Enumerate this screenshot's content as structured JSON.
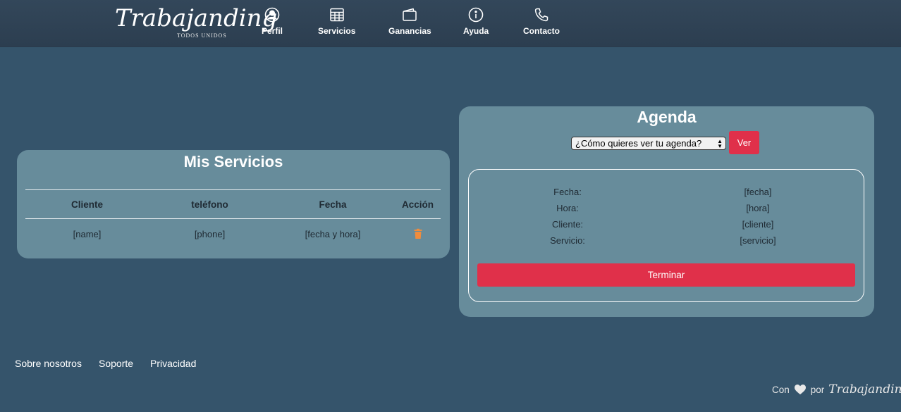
{
  "brand": {
    "name": "Trabajanding",
    "tagline": "TODOS UNIDOS"
  },
  "nav": [
    {
      "label": "Perfil",
      "icon": "person-circle-icon"
    },
    {
      "label": "Servicios",
      "icon": "table-grid-icon"
    },
    {
      "label": "Ganancias",
      "icon": "wallet-icon"
    },
    {
      "label": "Ayuda",
      "icon": "info-circle-icon"
    },
    {
      "label": "Contacto",
      "icon": "telephone-icon"
    }
  ],
  "services": {
    "title": "Mis Servicios",
    "columns": [
      "Cliente",
      "teléfono",
      "Fecha",
      "Acción"
    ],
    "rows": [
      {
        "cliente": "[name]",
        "telefono": "[phone]",
        "fecha": "[fecha y hora]",
        "action_icon": "trash-icon"
      }
    ]
  },
  "agenda": {
    "title": "Agenda",
    "select_value": "¿Cómo quieres ver tu agenda?",
    "view_button": "Ver",
    "fields": [
      {
        "label": "Fecha:",
        "value": "[fecha]"
      },
      {
        "label": "Hora:",
        "value": "[hora]"
      },
      {
        "label": "Cliente:",
        "value": "[cliente]"
      },
      {
        "label": "Servicio:",
        "value": "[servicio]"
      }
    ],
    "finish_button": "Terminar"
  },
  "footer": {
    "links": [
      "Sobre nosotros",
      "Soporte",
      "Privacidad"
    ],
    "credits_prefix": "Con",
    "credits_middle": "por",
    "credits_brand": "Trabajanding"
  },
  "colors": {
    "background": "#35546b",
    "navbar": "#2c3e50",
    "card": "#678c9b",
    "accent_red": "#e0304a",
    "trash_orange": "#f08c3c"
  }
}
